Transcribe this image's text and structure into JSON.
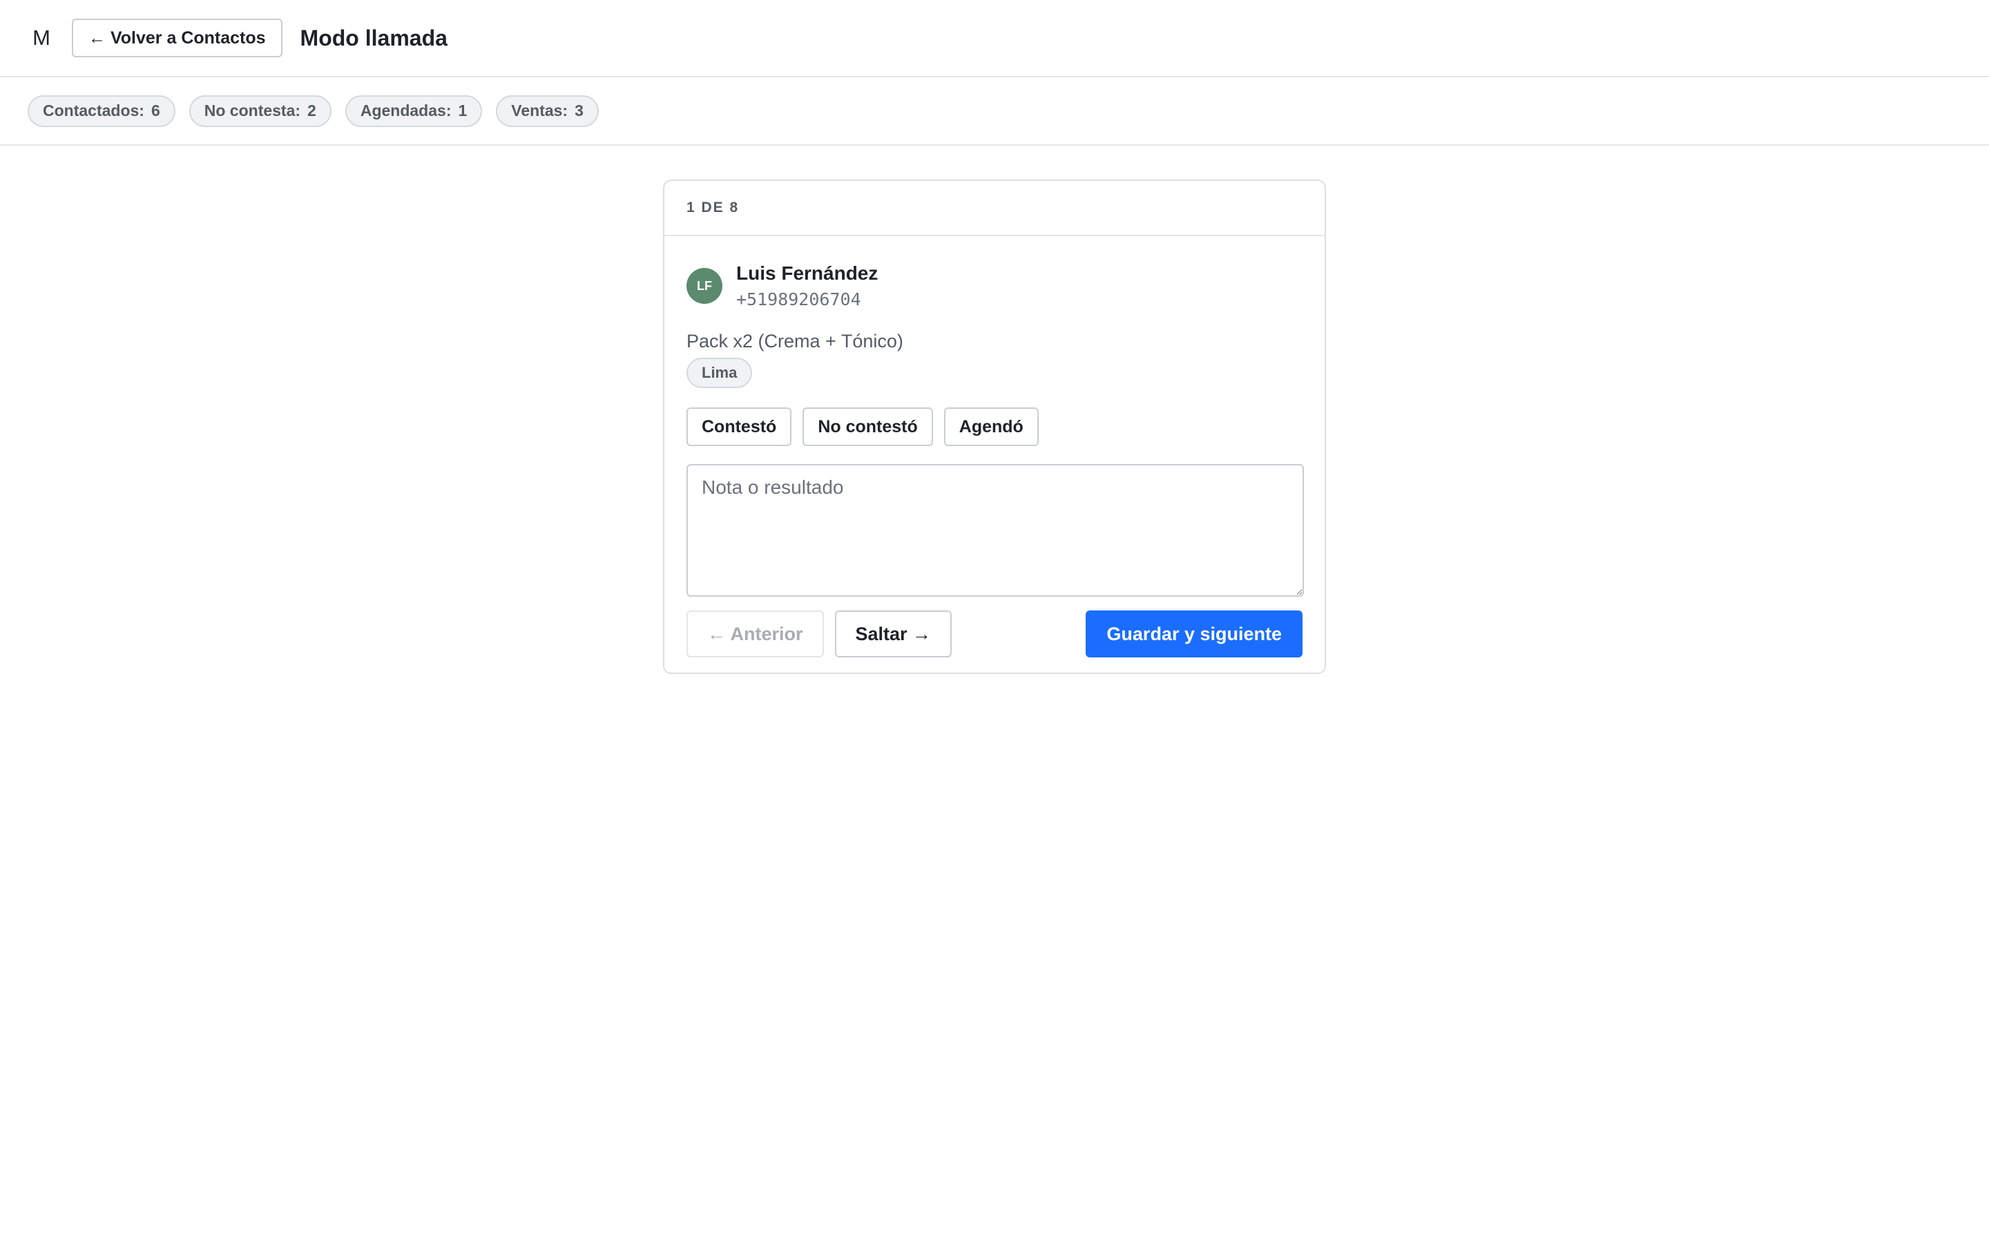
{
  "header": {
    "brand_letter": "M",
    "back_label": "← Volver a Contactos",
    "title": "Modo llamada"
  },
  "stats": [
    {
      "label": "Contactados:",
      "value": "6"
    },
    {
      "label": "No contesta:",
      "value": "2"
    },
    {
      "label": "Agendadas:",
      "value": "1"
    },
    {
      "label": "Ventas:",
      "value": "3"
    }
  ],
  "card": {
    "progress": "1 DE 8",
    "contact": {
      "initials": "LF",
      "name": "Luis Fernández",
      "phone": "+51989206704",
      "product": "Pack x2 (Crema + Tónico)",
      "tag": "Lima"
    },
    "outcomes": [
      "Contestó",
      "No contestó",
      "Agendó"
    ],
    "note": {
      "value": "",
      "placeholder": "Nota o resultado"
    },
    "nav": {
      "prev_label": "← Anterior",
      "skip_label": "Saltar →",
      "save_next_label": "Guardar y siguiente"
    }
  },
  "colors": {
    "primary": "#1a6dff",
    "avatar": "#5b8a6e"
  }
}
